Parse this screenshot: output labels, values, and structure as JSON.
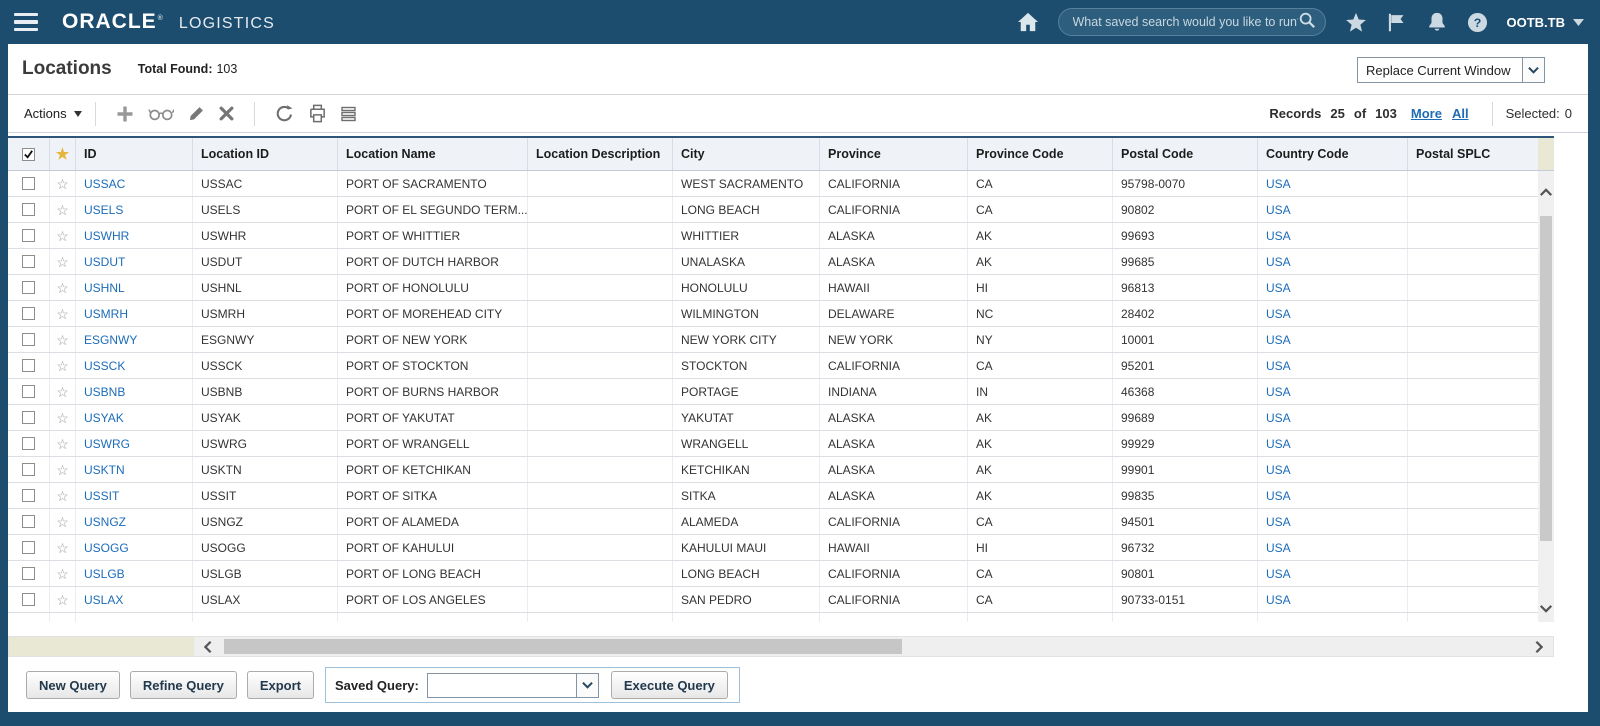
{
  "header": {
    "brand": "ORACLE",
    "registered_mark": "®",
    "product": "LOGISTICS",
    "search_placeholder": "What saved search would you like to run?",
    "username": "OOTB.TB"
  },
  "page": {
    "title": "Locations",
    "total_found_label": "Total Found:",
    "total_found_value": "103",
    "window_mode_selected": "Replace Current Window"
  },
  "toolbar": {
    "actions_label": "Actions",
    "records_label": "Records",
    "records_shown": "25",
    "records_of_label": "of",
    "records_total": "103",
    "more_link": "More",
    "all_link": "All",
    "selected_label": "Selected:",
    "selected_count": "0",
    "icons": [
      "add",
      "find",
      "edit",
      "delete",
      "undo",
      "print",
      "grid-view"
    ]
  },
  "table": {
    "columns": [
      "ID",
      "Location ID",
      "Location Name",
      "Location Description",
      "City",
      "Province",
      "Province Code",
      "Postal Code",
      "Country Code",
      "Postal SPLC"
    ],
    "rows": [
      {
        "id": "USSAC",
        "location_id": "USSAC",
        "location_name": "PORT OF SACRAMENTO",
        "location_description": "",
        "city": "WEST SACRAMENTO",
        "province": "CALIFORNIA",
        "province_code": "CA",
        "postal_code": "95798-0070",
        "country_code": "USA",
        "postal_splc": ""
      },
      {
        "id": "USELS",
        "location_id": "USELS",
        "location_name": "PORT OF EL SEGUNDO TERM...",
        "location_description": "",
        "city": "LONG BEACH",
        "province": "CALIFORNIA",
        "province_code": "CA",
        "postal_code": "90802",
        "country_code": "USA",
        "postal_splc": ""
      },
      {
        "id": "USWHR",
        "location_id": "USWHR",
        "location_name": "PORT OF WHITTIER",
        "location_description": "",
        "city": "WHITTIER",
        "province": "ALASKA",
        "province_code": "AK",
        "postal_code": "99693",
        "country_code": "USA",
        "postal_splc": ""
      },
      {
        "id": "USDUT",
        "location_id": "USDUT",
        "location_name": "PORT OF DUTCH HARBOR",
        "location_description": "",
        "city": "UNALASKA",
        "province": "ALASKA",
        "province_code": "AK",
        "postal_code": "99685",
        "country_code": "USA",
        "postal_splc": ""
      },
      {
        "id": "USHNL",
        "location_id": "USHNL",
        "location_name": "PORT OF HONOLULU",
        "location_description": "",
        "city": "HONOLULU",
        "province": "HAWAII",
        "province_code": "HI",
        "postal_code": "96813",
        "country_code": "USA",
        "postal_splc": ""
      },
      {
        "id": "USMRH",
        "location_id": "USMRH",
        "location_name": "PORT OF MOREHEAD CITY",
        "location_description": "",
        "city": "WILMINGTON",
        "province": "DELAWARE",
        "province_code": "NC",
        "postal_code": "28402",
        "country_code": "USA",
        "postal_splc": ""
      },
      {
        "id": "ESGNWY",
        "location_id": "ESGNWY",
        "location_name": "PORT OF NEW YORK",
        "location_description": "",
        "city": "NEW YORK CITY",
        "province": "NEW YORK",
        "province_code": "NY",
        "postal_code": "10001",
        "country_code": "USA",
        "postal_splc": ""
      },
      {
        "id": "USSCK",
        "location_id": "USSCK",
        "location_name": "PORT OF STOCKTON",
        "location_description": "",
        "city": "STOCKTON",
        "province": "CALIFORNIA",
        "province_code": "CA",
        "postal_code": "95201",
        "country_code": "USA",
        "postal_splc": ""
      },
      {
        "id": "USBNB",
        "location_id": "USBNB",
        "location_name": "PORT OF BURNS HARBOR",
        "location_description": "",
        "city": "PORTAGE",
        "province": "INDIANA",
        "province_code": "IN",
        "postal_code": "46368",
        "country_code": "USA",
        "postal_splc": ""
      },
      {
        "id": "USYAK",
        "location_id": "USYAK",
        "location_name": "PORT OF YAKUTAT",
        "location_description": "",
        "city": "YAKUTAT",
        "province": "ALASKA",
        "province_code": "AK",
        "postal_code": "99689",
        "country_code": "USA",
        "postal_splc": ""
      },
      {
        "id": "USWRG",
        "location_id": "USWRG",
        "location_name": "PORT OF WRANGELL",
        "location_description": "",
        "city": "WRANGELL",
        "province": "ALASKA",
        "province_code": "AK",
        "postal_code": "99929",
        "country_code": "USA",
        "postal_splc": ""
      },
      {
        "id": "USKTN",
        "location_id": "USKTN",
        "location_name": "PORT OF KETCHIKAN",
        "location_description": "",
        "city": "KETCHIKAN",
        "province": "ALASKA",
        "province_code": "AK",
        "postal_code": "99901",
        "country_code": "USA",
        "postal_splc": ""
      },
      {
        "id": "USSIT",
        "location_id": "USSIT",
        "location_name": "PORT OF SITKA",
        "location_description": "",
        "city": "SITKA",
        "province": "ALASKA",
        "province_code": "AK",
        "postal_code": "99835",
        "country_code": "USA",
        "postal_splc": ""
      },
      {
        "id": "USNGZ",
        "location_id": "USNGZ",
        "location_name": "PORT OF ALAMEDA",
        "location_description": "",
        "city": "ALAMEDA",
        "province": "CALIFORNIA",
        "province_code": "CA",
        "postal_code": "94501",
        "country_code": "USA",
        "postal_splc": ""
      },
      {
        "id": "USOGG",
        "location_id": "USOGG",
        "location_name": "PORT OF KAHULUI",
        "location_description": "",
        "city": "KAHULUI MAUI",
        "province": "HAWAII",
        "province_code": "HI",
        "postal_code": "96732",
        "country_code": "USA",
        "postal_splc": ""
      },
      {
        "id": "USLGB",
        "location_id": "USLGB",
        "location_name": "PORT OF LONG BEACH",
        "location_description": "",
        "city": "LONG BEACH",
        "province": "CALIFORNIA",
        "province_code": "CA",
        "postal_code": "90801",
        "country_code": "USA",
        "postal_splc": ""
      },
      {
        "id": "USLAX",
        "location_id": "USLAX",
        "location_name": "PORT OF LOS ANGELES",
        "location_description": "",
        "city": "SAN PEDRO",
        "province": "CALIFORNIA",
        "province_code": "CA",
        "postal_code": "90733-0151",
        "country_code": "USA",
        "postal_splc": ""
      }
    ]
  },
  "footer": {
    "new_query_label": "New Query",
    "refine_query_label": "Refine Query",
    "export_label": "Export",
    "saved_query_label": "Saved Query:",
    "saved_query_value": "",
    "execute_query_label": "Execute Query"
  },
  "colors": {
    "header_bg": "#1d4d6e",
    "link_blue": "#1c6cb8",
    "star_gold": "#e7b53c",
    "frozen_corner_beige": "#e9e8d4"
  }
}
